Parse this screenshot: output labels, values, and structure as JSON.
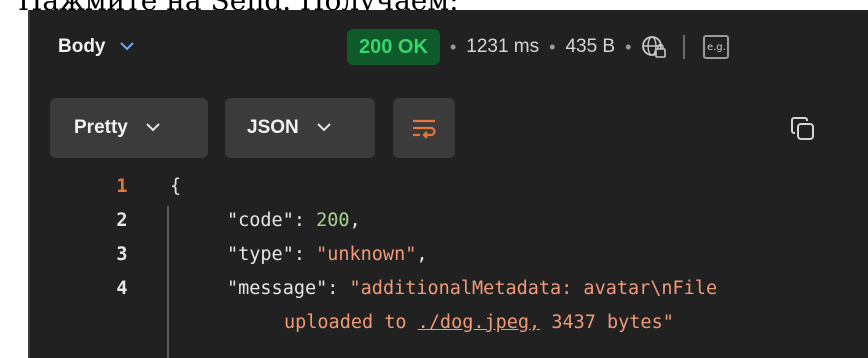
{
  "top_text": "Нажмите на Send. Получаем:",
  "response": {
    "tab_label": "Body",
    "status": "200 OK",
    "time": "1231 ms",
    "size": "435 B",
    "eg_label": "e.g."
  },
  "toolbar": {
    "format_label": "Pretty",
    "language_label": "JSON"
  },
  "code": {
    "line_numbers": [
      "1",
      "2",
      "3",
      "4"
    ],
    "open_brace": "{",
    "code_key": "\"code\"",
    "code_value": "200",
    "type_key": "\"type\"",
    "type_value": "\"unknown\"",
    "message_key": "\"message\"",
    "message_part1": "\"additionalMetadata: avatar\\nFile",
    "message_part2": "uploaded to ",
    "message_link": "./dog.jpeg,",
    "message_part3": " 3437 bytes\"",
    "colon": ": ",
    "comma": ","
  },
  "colors": {
    "panel_bg": "#212121",
    "status_green": "#39d36b",
    "accent_orange": "#e8763a",
    "string_color": "#f09a7a",
    "number_color": "#a6d28f"
  }
}
